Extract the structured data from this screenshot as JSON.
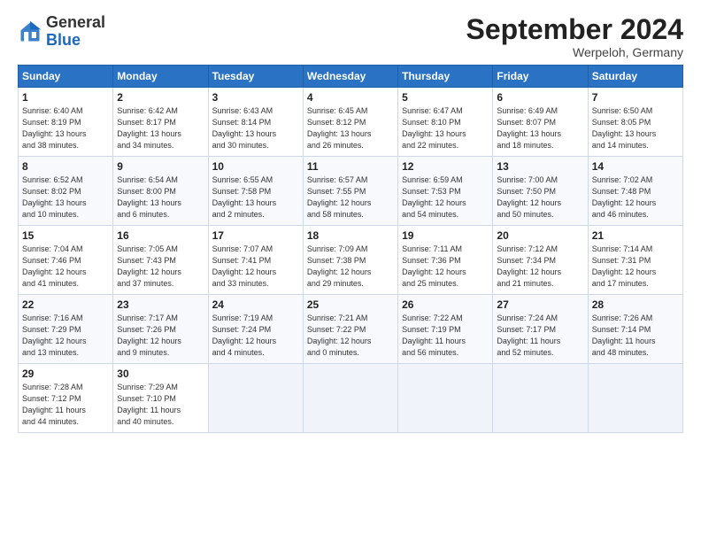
{
  "header": {
    "logo_general": "General",
    "logo_blue": "Blue",
    "month_title": "September 2024",
    "location": "Werpeloh, Germany"
  },
  "weekdays": [
    "Sunday",
    "Monday",
    "Tuesday",
    "Wednesday",
    "Thursday",
    "Friday",
    "Saturday"
  ],
  "weeks": [
    [
      {
        "day": "1",
        "lines": [
          "Sunrise: 6:40 AM",
          "Sunset: 8:19 PM",
          "Daylight: 13 hours",
          "and 38 minutes."
        ]
      },
      {
        "day": "2",
        "lines": [
          "Sunrise: 6:42 AM",
          "Sunset: 8:17 PM",
          "Daylight: 13 hours",
          "and 34 minutes."
        ]
      },
      {
        "day": "3",
        "lines": [
          "Sunrise: 6:43 AM",
          "Sunset: 8:14 PM",
          "Daylight: 13 hours",
          "and 30 minutes."
        ]
      },
      {
        "day": "4",
        "lines": [
          "Sunrise: 6:45 AM",
          "Sunset: 8:12 PM",
          "Daylight: 13 hours",
          "and 26 minutes."
        ]
      },
      {
        "day": "5",
        "lines": [
          "Sunrise: 6:47 AM",
          "Sunset: 8:10 PM",
          "Daylight: 13 hours",
          "and 22 minutes."
        ]
      },
      {
        "day": "6",
        "lines": [
          "Sunrise: 6:49 AM",
          "Sunset: 8:07 PM",
          "Daylight: 13 hours",
          "and 18 minutes."
        ]
      },
      {
        "day": "7",
        "lines": [
          "Sunrise: 6:50 AM",
          "Sunset: 8:05 PM",
          "Daylight: 13 hours",
          "and 14 minutes."
        ]
      }
    ],
    [
      {
        "day": "8",
        "lines": [
          "Sunrise: 6:52 AM",
          "Sunset: 8:02 PM",
          "Daylight: 13 hours",
          "and 10 minutes."
        ]
      },
      {
        "day": "9",
        "lines": [
          "Sunrise: 6:54 AM",
          "Sunset: 8:00 PM",
          "Daylight: 13 hours",
          "and 6 minutes."
        ]
      },
      {
        "day": "10",
        "lines": [
          "Sunrise: 6:55 AM",
          "Sunset: 7:58 PM",
          "Daylight: 13 hours",
          "and 2 minutes."
        ]
      },
      {
        "day": "11",
        "lines": [
          "Sunrise: 6:57 AM",
          "Sunset: 7:55 PM",
          "Daylight: 12 hours",
          "and 58 minutes."
        ]
      },
      {
        "day": "12",
        "lines": [
          "Sunrise: 6:59 AM",
          "Sunset: 7:53 PM",
          "Daylight: 12 hours",
          "and 54 minutes."
        ]
      },
      {
        "day": "13",
        "lines": [
          "Sunrise: 7:00 AM",
          "Sunset: 7:50 PM",
          "Daylight: 12 hours",
          "and 50 minutes."
        ]
      },
      {
        "day": "14",
        "lines": [
          "Sunrise: 7:02 AM",
          "Sunset: 7:48 PM",
          "Daylight: 12 hours",
          "and 46 minutes."
        ]
      }
    ],
    [
      {
        "day": "15",
        "lines": [
          "Sunrise: 7:04 AM",
          "Sunset: 7:46 PM",
          "Daylight: 12 hours",
          "and 41 minutes."
        ]
      },
      {
        "day": "16",
        "lines": [
          "Sunrise: 7:05 AM",
          "Sunset: 7:43 PM",
          "Daylight: 12 hours",
          "and 37 minutes."
        ]
      },
      {
        "day": "17",
        "lines": [
          "Sunrise: 7:07 AM",
          "Sunset: 7:41 PM",
          "Daylight: 12 hours",
          "and 33 minutes."
        ]
      },
      {
        "day": "18",
        "lines": [
          "Sunrise: 7:09 AM",
          "Sunset: 7:38 PM",
          "Daylight: 12 hours",
          "and 29 minutes."
        ]
      },
      {
        "day": "19",
        "lines": [
          "Sunrise: 7:11 AM",
          "Sunset: 7:36 PM",
          "Daylight: 12 hours",
          "and 25 minutes."
        ]
      },
      {
        "day": "20",
        "lines": [
          "Sunrise: 7:12 AM",
          "Sunset: 7:34 PM",
          "Daylight: 12 hours",
          "and 21 minutes."
        ]
      },
      {
        "day": "21",
        "lines": [
          "Sunrise: 7:14 AM",
          "Sunset: 7:31 PM",
          "Daylight: 12 hours",
          "and 17 minutes."
        ]
      }
    ],
    [
      {
        "day": "22",
        "lines": [
          "Sunrise: 7:16 AM",
          "Sunset: 7:29 PM",
          "Daylight: 12 hours",
          "and 13 minutes."
        ]
      },
      {
        "day": "23",
        "lines": [
          "Sunrise: 7:17 AM",
          "Sunset: 7:26 PM",
          "Daylight: 12 hours",
          "and 9 minutes."
        ]
      },
      {
        "day": "24",
        "lines": [
          "Sunrise: 7:19 AM",
          "Sunset: 7:24 PM",
          "Daylight: 12 hours",
          "and 4 minutes."
        ]
      },
      {
        "day": "25",
        "lines": [
          "Sunrise: 7:21 AM",
          "Sunset: 7:22 PM",
          "Daylight: 12 hours",
          "and 0 minutes."
        ]
      },
      {
        "day": "26",
        "lines": [
          "Sunrise: 7:22 AM",
          "Sunset: 7:19 PM",
          "Daylight: 11 hours",
          "and 56 minutes."
        ]
      },
      {
        "day": "27",
        "lines": [
          "Sunrise: 7:24 AM",
          "Sunset: 7:17 PM",
          "Daylight: 11 hours",
          "and 52 minutes."
        ]
      },
      {
        "day": "28",
        "lines": [
          "Sunrise: 7:26 AM",
          "Sunset: 7:14 PM",
          "Daylight: 11 hours",
          "and 48 minutes."
        ]
      }
    ],
    [
      {
        "day": "29",
        "lines": [
          "Sunrise: 7:28 AM",
          "Sunset: 7:12 PM",
          "Daylight: 11 hours",
          "and 44 minutes."
        ]
      },
      {
        "day": "30",
        "lines": [
          "Sunrise: 7:29 AM",
          "Sunset: 7:10 PM",
          "Daylight: 11 hours",
          "and 40 minutes."
        ]
      },
      null,
      null,
      null,
      null,
      null
    ]
  ]
}
